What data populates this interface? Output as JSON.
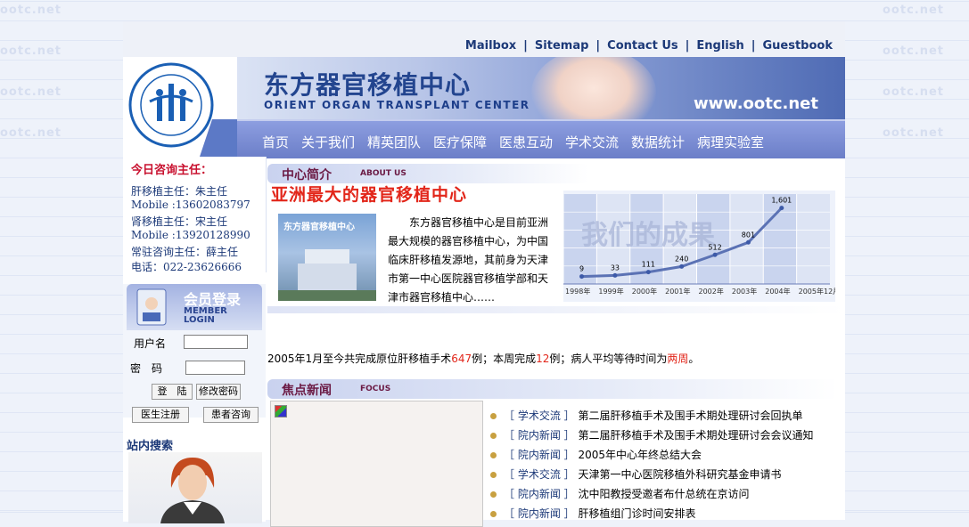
{
  "top_links": [
    "Mailbox",
    "Sitemap",
    "Contact Us",
    "English",
    "Guestbook"
  ],
  "logo": {
    "alt_text": "Orient Organ Transplant Center"
  },
  "banner": {
    "title": "东方器官移植中心",
    "subtitle": "ORIENT ORGAN TRANSPLANT CENTER",
    "url": "www.ootc.net"
  },
  "nav": [
    "首页",
    "关于我们",
    "精英团队",
    "医疗保障",
    "医患互动",
    "学术交流",
    "数据统计",
    "病理实验室"
  ],
  "consult": {
    "title": "今日咨询主任：",
    "lines": [
      "肝移植主任：朱主任",
      "Mobile :13602083797",
      "肾移植主任：宋主任",
      "Mobile :13920128990",
      "常驻咨询主任：薛主任",
      "电话：022-23626666"
    ]
  },
  "member": {
    "title": "会员登录",
    "subtitle_1": "MEMBER",
    "subtitle_2": "LOGIN",
    "username_label": "用户名",
    "password_label": "密　码",
    "login_button": "登　陆",
    "change_password_button": "修改密码",
    "doctor_register_button": "医生注册",
    "patient_consult_button": "患者咨询"
  },
  "search": {
    "title": "站内搜索"
  },
  "intro_section": {
    "title_cn": "中心简介",
    "title_en": "ABOUT US",
    "slogan": "亚洲最大的器官移植中心",
    "image_label": "东方器官移植中心",
    "text": "东方器官移植中心是目前亚洲最大规模的器官移植中心，为中国临床肝移植发源地，其前身为天津市第一中心医院器官移植学部和天津市器官移植中心……"
  },
  "chart_data": {
    "type": "line",
    "title": "我们的成果",
    "categories": [
      "1998年",
      "1999年",
      "2000年",
      "2001年",
      "2002年",
      "2003年",
      "2004年",
      "2005年12月"
    ],
    "values": [
      9,
      33,
      111,
      240,
      512,
      801,
      1601
    ],
    "value_labels": [
      "9",
      "33",
      "111",
      "240",
      "512",
      "801",
      "1,601"
    ],
    "ylim": [
      0,
      1800
    ],
    "grid": true
  },
  "stats": {
    "prefix": "2005年1月至今共完成原位肝移植手术",
    "total": "647",
    "mid": "例；本周完成",
    "week": "12",
    "mid2": "例；病人平均等待时间为",
    "wait": "两周",
    "suffix": "。"
  },
  "news_section": {
    "title_cn": "焦点新闻",
    "title_en": "FOCUS"
  },
  "news": [
    {
      "tag": "［ 学术交流 ］",
      "title": "第二届肝移植手术及围手术期处理研讨会回执单"
    },
    {
      "tag": "［ 院内新闻 ］",
      "title": "第二届肝移植手术及围手术期处理研讨会会议通知"
    },
    {
      "tag": "［ 院内新闻 ］",
      "title": "2005年中心年终总结大会"
    },
    {
      "tag": "［ 学术交流 ］",
      "title": "天津第一中心医院移植外科研究基金申请书"
    },
    {
      "tag": "［ 院内新闻 ］",
      "title": "沈中阳教授受邀者布什总统在京访问"
    },
    {
      "tag": "［ 院内新闻 ］",
      "title": "肝移植组门诊时间安排表"
    }
  ],
  "colors": {
    "brand_blue": "#23458f",
    "nav_blue": "#6b7ec8",
    "accent_red": "#e2261a",
    "section_maroon": "#6b1a44"
  }
}
